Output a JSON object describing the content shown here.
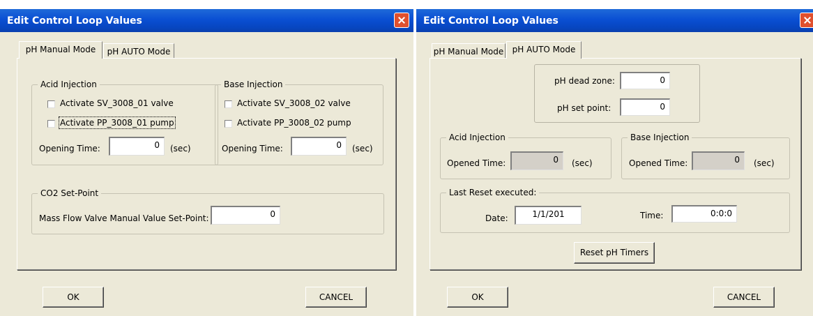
{
  "left_dialog": {
    "title": "Edit Control Loop Values",
    "tabs": [
      "pH Manual Mode",
      "pH AUTO Mode"
    ],
    "acid_injection": {
      "legend": "Acid Injection",
      "checkbox_valve": "Activate SV_3008_01 valve",
      "checkbox_pump": "Activate PP_3008_01 pump",
      "opening_time_label": "Opening Time:",
      "opening_time_value": "0",
      "unit": "(sec)"
    },
    "base_injection": {
      "legend": "Base Injection",
      "checkbox_valve": "Activate SV_3008_02 valve",
      "checkbox_pump": "Activate PP_3008_02 pump",
      "opening_time_label": "Opening Time:",
      "opening_time_value": "0",
      "unit": "(sec)"
    },
    "co2": {
      "legend": "CO2 Set-Point",
      "label": "Mass Flow Valve Manual Value Set-Point:",
      "value": "0"
    },
    "ok_label": "OK",
    "cancel_label": "CANCEL"
  },
  "right_dialog": {
    "title": "Edit Control Loop Values",
    "tabs": [
      "pH Manual Mode",
      "pH AUTO Mode"
    ],
    "dead_zone_label": "pH dead zone:",
    "dead_zone_value": "0",
    "set_point_label": "pH set point:",
    "set_point_value": "0",
    "acid_injection": {
      "legend": "Acid Injection",
      "label": "Opened Time:",
      "value": "0",
      "unit": "(sec)"
    },
    "base_injection": {
      "legend": "Base Injection",
      "label": "Opened Time:",
      "value": "0",
      "unit": "(sec)"
    },
    "last_reset": {
      "legend": "Last Reset executed:",
      "date_label": "Date:",
      "date_value": "1/1/201",
      "time_label": "Time:",
      "time_value": "0:0:0"
    },
    "reset_button": "Reset pH Timers",
    "ok_label": "OK",
    "cancel_label": "CANCEL"
  },
  "colors": {
    "title_bar": "#0a4fd3",
    "close_button": "#e0502e",
    "dialog_bg": "#ece9d8"
  }
}
